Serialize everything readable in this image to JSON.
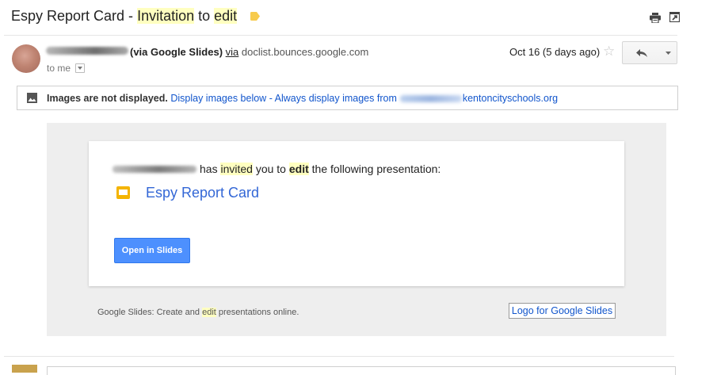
{
  "subject": {
    "part1": "Espy Report Card - ",
    "part2": "Invitation",
    "part3": " to ",
    "part4": "edit"
  },
  "toolbar": {
    "label_icon": "label-tag-icon",
    "print_icon": "print-icon",
    "new_window_icon": "new-window-icon"
  },
  "sender": {
    "via_label": "(via Google Slides)",
    "via_word": "via",
    "domain": "doclist.bounces.google.com",
    "recipient": "to me",
    "date": "Oct 16 (5 days ago)"
  },
  "images_notice": {
    "bold": "Images are not displayed.",
    "display_below": "Display images below",
    "separator": " - ",
    "always_display": "Always display images from",
    "domain_suffix": "kentoncityschools.org"
  },
  "message": {
    "invite_has": "has ",
    "invite_invited": "invited",
    "invite_mid": " you to ",
    "invite_edit": "edit",
    "invite_end": " the following presentation:",
    "doc_title": "Espy Report Card",
    "open_button": "Open in Slides",
    "footer_part1": "Google Slides: Create and ",
    "footer_edit": "edit",
    "footer_part2": " presentations online.",
    "logo_link": "Logo for Google Slides"
  },
  "colors": {
    "accent_blue": "#4d90fe",
    "link_blue": "#1155cc",
    "slides_yellow": "#f4b400",
    "label_tag": "#f7cb4d",
    "highlight": "#ffffc0"
  }
}
